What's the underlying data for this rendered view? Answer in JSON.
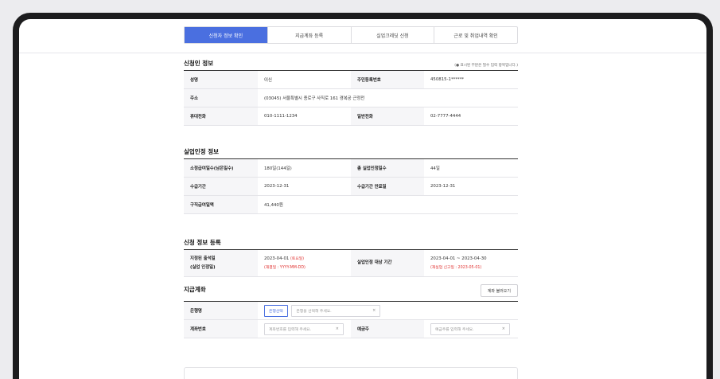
{
  "tabs": [
    {
      "label": "신청자 정보 확인",
      "active": true
    },
    {
      "label": "지급계좌 등록",
      "active": false
    },
    {
      "label": "실업크레딧 신청",
      "active": false
    },
    {
      "label": "근로 및 취업내역 확인",
      "active": false
    }
  ],
  "applicant": {
    "title": "신청인 정보",
    "note_star": "(● 표시된 부분은 필수 입력 항목입니다.)",
    "name_label": "성명",
    "name_value": "이신",
    "rrn_label": "주민등록번호",
    "rrn_value": "450815-1******",
    "address_label": "주소",
    "address_value": "(03045) 서울특별시 종로구 사직로 161 경복궁 근정전",
    "mobile_label": "휴대전화",
    "mobile_value": "010-1111-1234",
    "phone_label": "일반전화",
    "phone_value": "02-7777-4444"
  },
  "recognition": {
    "title": "실업인정 정보",
    "days_label": "소정급여일수(남은일수)",
    "days_value": "180일(144일)",
    "total_label": "총 실업인정일수",
    "total_value": "44일",
    "period_label": "수급기간",
    "period_value": "2023-12-31",
    "end_label": "수급기간 만료일",
    "end_value": "2023-12-31",
    "daily_label": "구직급여일액",
    "daily_value": "41,440원"
  },
  "registration": {
    "title": "신청 정보 등록",
    "attend_label_1": "지정된 출석일",
    "attend_label_2": "(실업 인정일)",
    "attend_value": "2023-04-01",
    "attend_day": "(토요일)",
    "attend_hint": "(재결일 : YYYY-MM-DD)",
    "target_label": "실업인정 대상 기간",
    "target_value": "2023-04-01 ~ 2023-04-30",
    "target_hint": "(재실업 신고일 : 2023-05-01)"
  },
  "account": {
    "title": "지급계좌",
    "load_button": "계좌 불러오기",
    "bank_label": "은행명",
    "bank_select": "은행선택",
    "bank_placeholder": "은행을 선택해 주세요.",
    "acct_label": "계좌번호",
    "acct_placeholder": "계좌번호를 입력해 주세요.",
    "owner_label": "예금주",
    "owner_placeholder": "예금주를 입력해 주세요.",
    "clear_icon": "×"
  },
  "colors": {
    "accent": "#4a6fe0",
    "required": "#e0302f"
  }
}
